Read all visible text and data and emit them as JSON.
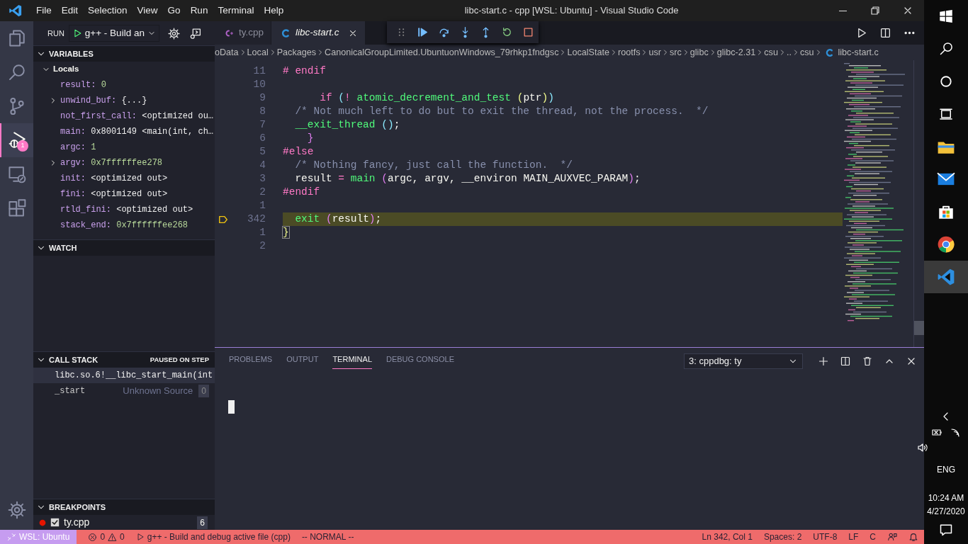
{
  "window": {
    "title": "libc-start.c - cpp [WSL: Ubuntu] - Visual Studio Code"
  },
  "menu": [
    "File",
    "Edit",
    "Selection",
    "View",
    "Go",
    "Run",
    "Terminal",
    "Help"
  ],
  "activity_bar": [
    {
      "kind": "explorer",
      "selected": false
    },
    {
      "kind": "search",
      "selected": false
    },
    {
      "kind": "source-control",
      "selected": false
    },
    {
      "kind": "run",
      "selected": true,
      "badge": "1"
    },
    {
      "kind": "remote",
      "selected": false
    },
    {
      "kind": "extensions",
      "selected": false
    }
  ],
  "sidebar": {
    "title": "RUN",
    "configuration": "g++ - Build an",
    "variables": {
      "title": "VARIABLES",
      "expanded": true,
      "scope": {
        "label": "Locals",
        "expanded": true,
        "items": [
          {
            "name": "result:",
            "value": "0",
            "color": "#b8d99b",
            "expandable": false
          },
          {
            "name": "unwind_buf:",
            "value": "{...}",
            "color": "#f0f0f0",
            "expandable": true
          },
          {
            "name": "not_first_call:",
            "value": "<optimized ou…",
            "color": "#f0f0f0",
            "expandable": false
          },
          {
            "name": "main:",
            "value": "0x8001149 <main(int, ch…",
            "color": "#f0f0f0",
            "expandable": false
          },
          {
            "name": "argc:",
            "value": "1",
            "color": "#b8d99b",
            "expandable": false
          },
          {
            "name": "argv:",
            "value": "0x7ffffffee278",
            "color": "#b8d99b",
            "expandable": true
          },
          {
            "name": "init:",
            "value": "<optimized out>",
            "color": "#f0f0f0",
            "expandable": false
          },
          {
            "name": "fini:",
            "value": "<optimized out>",
            "color": "#f0f0f0",
            "expandable": false
          },
          {
            "name": "rtld_fini:",
            "value": "<optimized out>",
            "color": "#f0f0f0",
            "expandable": false
          },
          {
            "name": "stack_end:",
            "value": "0x7ffffffee268",
            "color": "#b8d99b",
            "expandable": false
          }
        ]
      }
    },
    "watch": {
      "title": "WATCH",
      "expanded": true
    },
    "call_stack": {
      "title": "CALL STACK",
      "status": "PAUSED ON STEP",
      "expanded": true,
      "frames": [
        {
          "name": "libc.so.6!__libc_start_main(int",
          "selected": true
        },
        {
          "name": "_start",
          "source": "Unknown Source",
          "badge": "0",
          "selected": false
        }
      ]
    },
    "breakpoints": {
      "title": "BREAKPOINTS",
      "expanded": true,
      "items": [
        {
          "file": "ty.cpp",
          "checked": true,
          "count": "6"
        }
      ]
    }
  },
  "tabs": [
    {
      "label": "ty.cpp",
      "kind": "cpp",
      "selected": false,
      "preview": false
    },
    {
      "label": "libc-start.c",
      "kind": "c",
      "selected": true,
      "preview": true
    }
  ],
  "breadcrumbs": {
    "segments": [
      "oData",
      "Local",
      "Packages",
      "CanonicalGroupLimited.UbuntuonWindows_79rhkp1fndgsc",
      "LocalState",
      "rootfs",
      "usr",
      "src",
      "glibc",
      "glibc-2.31",
      "csu",
      "..",
      "csu"
    ],
    "file": "libc-start.c"
  },
  "editor": {
    "lines": [
      {
        "number": "11",
        "current": false,
        "tokens": [
          {
            "text": "# endif",
            "kind": "kw"
          }
        ]
      },
      {
        "number": "10",
        "current": false
      },
      {
        "number": "9",
        "current": false,
        "tokens": [
          {
            "text": "      if",
            "kind": "kw"
          },
          {
            "text": " (",
            "kind": "p3"
          },
          {
            "text": "!",
            "kind": "kw"
          },
          {
            "text": " atomic_decrement_and_test ",
            "kind": "fn"
          },
          {
            "text": "(",
            "kind": "p1"
          },
          {
            "text": "ptr",
            "kind": "id"
          },
          {
            "text": ")",
            "kind": "p1"
          },
          {
            "text": ")",
            "kind": "p3"
          }
        ]
      },
      {
        "number": "8",
        "current": false,
        "tokens": [
          {
            "text": "  /* Not much left to do but to exit the thread, not the process.  */",
            "kind": "cm"
          }
        ]
      },
      {
        "number": "7",
        "current": false,
        "tokens": [
          {
            "text": "  __exit_thread ",
            "kind": "fn"
          },
          {
            "text": "()",
            "kind": "p3"
          },
          {
            "text": ";",
            "kind": "id"
          }
        ]
      },
      {
        "number": "6",
        "current": false,
        "tokens": [
          {
            "text": "    }",
            "kind": "p2"
          }
        ]
      },
      {
        "number": "5",
        "current": false,
        "tokens": [
          {
            "text": "#else",
            "kind": "kw"
          }
        ]
      },
      {
        "number": "4",
        "current": false,
        "tokens": [
          {
            "text": "  /* Nothing fancy, just call the function.  */",
            "kind": "cm"
          }
        ]
      },
      {
        "number": "3",
        "current": false,
        "tokens": [
          {
            "text": "  result ",
            "kind": "id"
          },
          {
            "text": "=",
            "kind": "kw"
          },
          {
            "text": " main ",
            "kind": "fn"
          },
          {
            "text": "(",
            "kind": "p2"
          },
          {
            "text": "argc, argv, __environ MAIN_AUXVEC_PARAM",
            "kind": "id"
          },
          {
            "text": ")",
            "kind": "p2"
          },
          {
            "text": ";",
            "kind": "id"
          }
        ]
      },
      {
        "number": "2",
        "current": false,
        "tokens": [
          {
            "text": "#endif",
            "kind": "kw"
          }
        ]
      },
      {
        "number": "1",
        "current": false
      },
      {
        "number": "342",
        "current": true,
        "tokens": [
          {
            "text": "  exit ",
            "kind": "fn"
          },
          {
            "text": "(",
            "kind": "p2"
          },
          {
            "text": "result",
            "kind": "id"
          },
          {
            "text": ")",
            "kind": "p2"
          },
          {
            "text": ";",
            "kind": "id"
          }
        ]
      },
      {
        "number": "1",
        "current": false,
        "tokens": [
          {
            "text": "}",
            "kind": "bm"
          }
        ]
      },
      {
        "number": "2",
        "current": false
      }
    ]
  },
  "panel": {
    "tabs": [
      {
        "label": "PROBLEMS",
        "selected": false
      },
      {
        "label": "OUTPUT",
        "selected": false
      },
      {
        "label": "TERMINAL",
        "selected": true
      },
      {
        "label": "DEBUG CONSOLE",
        "selected": false
      }
    ],
    "terminal": "3: cppdbg: ty"
  },
  "status_bar": {
    "remote": "WSL: Ubuntu",
    "errors": "0",
    "warnings": "0",
    "launch": "g++ - Build and debug active file (cpp)",
    "mode": "-- NORMAL --",
    "right": [
      "Ln 342, Col 1",
      "Spaces: 2",
      "UTF-8",
      "LF",
      "C"
    ]
  },
  "taskbar": {
    "apps": [
      {
        "kind": "file-explorer",
        "selected": false
      },
      {
        "kind": "mail",
        "selected": false
      },
      {
        "kind": "store",
        "selected": false
      },
      {
        "kind": "chrome",
        "selected": false
      },
      {
        "kind": "vscode",
        "selected": true
      }
    ],
    "language": "ENG",
    "time": "10:24 AM",
    "date": "4/27/2020"
  }
}
